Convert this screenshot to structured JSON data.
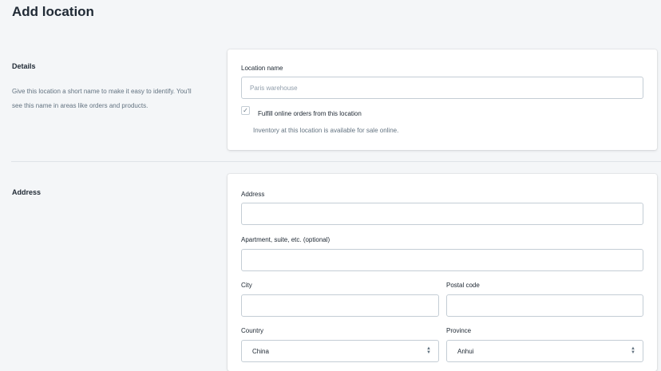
{
  "page": {
    "title": "Add location"
  },
  "details": {
    "heading": "Details",
    "description": "Give this location a short name to make it easy to identify. You'll see this name in areas like orders and products.",
    "location_name_label": "Location name",
    "location_name_placeholder": "Paris warehouse",
    "location_name_value": "",
    "fulfill_checked": true,
    "fulfill_label": "Fulfill online orders from this location",
    "fulfill_help": "Inventory at this location is available for sale online."
  },
  "address": {
    "heading": "Address",
    "address_label": "Address",
    "address_value": "",
    "apartment_label": "Apartment, suite, etc. (optional)",
    "apartment_value": "",
    "city_label": "City",
    "city_value": "",
    "postal_label": "Postal code",
    "postal_value": "",
    "country_label": "Country",
    "country_value": "China",
    "province_label": "Province",
    "province_value": "Anhui"
  },
  "icons": {
    "check": "checkmark-icon",
    "select": "select-arrows-icon"
  }
}
